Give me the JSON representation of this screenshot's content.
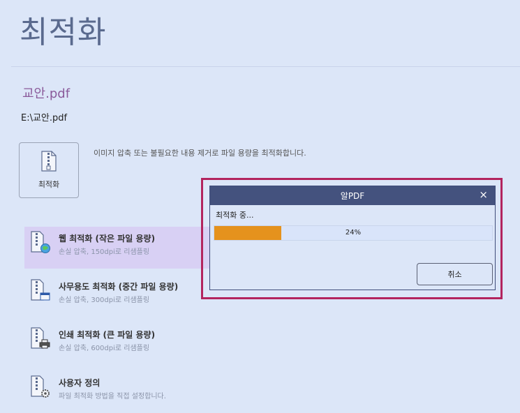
{
  "page": {
    "title": "최적화"
  },
  "file": {
    "name": "교안.pdf",
    "path": "E:\\교안.pdf"
  },
  "optimize": {
    "button_label": "최적화",
    "description": "이미지 압축 또는 불필요한 내용 제거로 파일 용량을 최적화합니다."
  },
  "presets": [
    {
      "title": "웹 최적화 (작은 파일 용량)",
      "subtitle": "손실 압축, 150dpi로 리샘플링"
    },
    {
      "title": "사무용도 최적화 (중간 파일 용량)",
      "subtitle": "손실 압축, 300dpi로 리샘플링"
    },
    {
      "title": "인쇄 최적화 (큰 파일 용량)",
      "subtitle": "손실 압축, 600dpi로 리샘플링"
    },
    {
      "title": "사용자 정의",
      "subtitle": "파일 최적화 방법을 직접 설정합니다."
    }
  ],
  "dialog": {
    "title": "알PDF",
    "status": "최적화 중...",
    "progress_percent": 24,
    "progress_label": "24%",
    "cancel_label": "취소",
    "close_glyph": "×"
  },
  "colors": {
    "background": "#dce6f8",
    "selected_bg": "#d8d0f4",
    "dialog_title_bg": "#44527e",
    "progress_fill": "#e5921d",
    "highlight_border": "#b3245e"
  },
  "icons": [
    "pdf-zip-icon",
    "globe-icon",
    "window-icon",
    "printer-icon",
    "gear-icon",
    "close-icon"
  ]
}
